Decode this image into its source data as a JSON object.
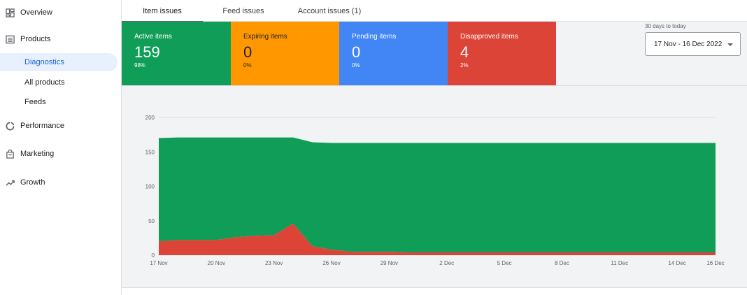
{
  "sidebar": {
    "items": [
      {
        "label": "Overview",
        "icon": "dashboard-icon"
      },
      {
        "label": "Products",
        "icon": "list-icon"
      },
      {
        "label": "Performance",
        "icon": "ring-chart-icon"
      },
      {
        "label": "Marketing",
        "icon": "bag-icon"
      },
      {
        "label": "Growth",
        "icon": "trending-up-icon"
      }
    ],
    "subitems": [
      {
        "label": "Diagnostics",
        "active": true
      },
      {
        "label": "All products",
        "active": false
      },
      {
        "label": "Feeds",
        "active": false
      }
    ]
  },
  "tabs": [
    {
      "label": "Item issues",
      "active": true
    },
    {
      "label": "Feed issues",
      "active": false
    },
    {
      "label": "Account issues (1)",
      "active": false
    }
  ],
  "cards": [
    {
      "label": "Active items",
      "value": "159",
      "pct": "98%",
      "color": "#0f9d58"
    },
    {
      "label": "Expiring items",
      "value": "0",
      "pct": "0%",
      "color": "#ff9800"
    },
    {
      "label": "Pending items",
      "value": "0",
      "pct": "0%",
      "color": "#4285f4"
    },
    {
      "label": "Disapproved items",
      "value": "4",
      "pct": "2%",
      "color": "#db4437"
    }
  ],
  "date_range": {
    "caption": "30 days to today",
    "value": "17 Nov - 16 Dec 2022"
  },
  "chart_data": {
    "type": "area",
    "stacked": true,
    "ylim": [
      0,
      200
    ],
    "yticks": [
      0,
      50,
      100,
      150,
      200
    ],
    "xticks": [
      "17 Nov",
      "20 Nov",
      "23 Nov",
      "26 Nov",
      "29 Nov",
      "2 Dec",
      "5 Dec",
      "8 Dec",
      "11 Dec",
      "14 Dec",
      "16 Dec"
    ],
    "x": [
      "17 Nov",
      "18 Nov",
      "19 Nov",
      "20 Nov",
      "21 Nov",
      "22 Nov",
      "23 Nov",
      "24 Nov",
      "25 Nov",
      "26 Nov",
      "27 Nov",
      "28 Nov",
      "29 Nov",
      "30 Nov",
      "1 Dec",
      "2 Dec",
      "3 Dec",
      "4 Dec",
      "5 Dec",
      "6 Dec",
      "7 Dec",
      "8 Dec",
      "9 Dec",
      "10 Dec",
      "11 Dec",
      "12 Dec",
      "13 Dec",
      "14 Dec",
      "15 Dec",
      "16 Dec"
    ],
    "series": [
      {
        "name": "Disapproved items",
        "color": "#db4437",
        "values": [
          20,
          22,
          22,
          22,
          26,
          28,
          29,
          46,
          13,
          8,
          5,
          5,
          5,
          4,
          4,
          4,
          4,
          4,
          4,
          4,
          4,
          4,
          4,
          4,
          4,
          4,
          4,
          4,
          4,
          4
        ]
      },
      {
        "name": "Active items",
        "color": "#0f9d58",
        "values": [
          150,
          149,
          149,
          149,
          145,
          143,
          142,
          125,
          151,
          155,
          158,
          158,
          158,
          159,
          159,
          159,
          159,
          159,
          159,
          159,
          159,
          159,
          159,
          159,
          159,
          159,
          159,
          159,
          159,
          159
        ]
      }
    ]
  }
}
